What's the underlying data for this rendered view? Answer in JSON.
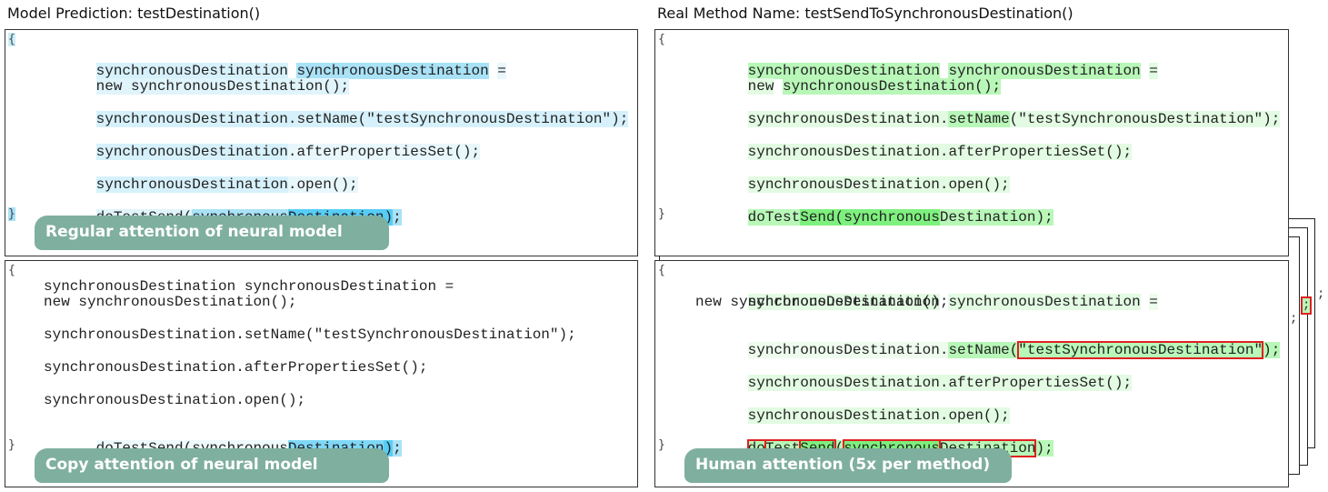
{
  "titles": {
    "left": "Model Prediction: testDestination()",
    "right": "Real Method Name: testSendToSynchronousDestination()"
  },
  "braces": {
    "open": "{",
    "close": "}"
  },
  "code_lines": [
    "synchronousDestination synchronousDestination =",
    "new synchronousDestination();",
    "synchronousDestination.setName(\"testSynchronousDestination\");",
    "synchronousDestination.afterPropertiesSet();",
    "synchronousDestination.open();",
    "doTestSend(synchronousDestination);"
  ],
  "panels": {
    "regular": {
      "label": "Regular attention of neural model"
    },
    "copy": {
      "label": "Copy attention of neural model"
    },
    "real_top": {
      "label": ""
    },
    "human": {
      "label": "Human attention (5x per method)"
    }
  },
  "stack_glyphs": {
    "semicolon": ";"
  },
  "colors": {
    "blue_light": "#d6f1fb",
    "blue_mid": "#a9e2f7",
    "blue_strong": "#57cdf5",
    "green_light": "#e2fbe2",
    "green_mid": "#b8f7b8",
    "green_strong": "#7ef07e",
    "pill": "#7faf9f",
    "red_box": "#e02020"
  }
}
